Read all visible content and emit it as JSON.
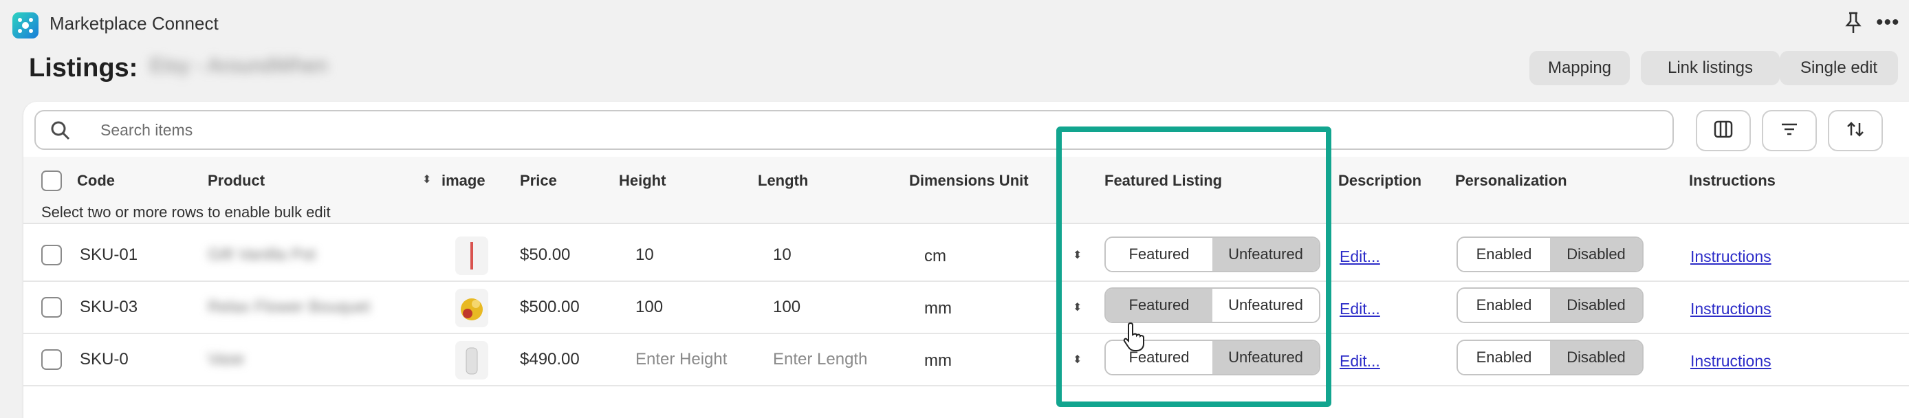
{
  "app": {
    "title": "Marketplace Connect"
  },
  "page": {
    "title": "Listings:",
    "store_name": "Etsy - AroundWhen"
  },
  "toolbar": {
    "mapping": "Mapping",
    "link_listings": "Link listings",
    "single_edit": "Single edit"
  },
  "search": {
    "placeholder": "Search items"
  },
  "table": {
    "columns": {
      "code": "Code",
      "product": "Product",
      "image": "image",
      "price": "Price",
      "height": "Height",
      "length": "Length",
      "dimensions_unit": "Dimensions Unit",
      "featured_listing": "Featured Listing",
      "description": "Description",
      "personalization": "Personalization",
      "instructions": "Instructions"
    },
    "bulk_note": "Select two or more rows to enable bulk edit",
    "rows": [
      {
        "code": "SKU-01",
        "product": "Gift Vanilla Pot",
        "price": "$50.00",
        "height": "10",
        "length": "10",
        "unit": "cm",
        "featured": "Featured",
        "unfeatured": "Unfeatured",
        "featured_state": "unfeatured",
        "description": "Edit...",
        "enabled": "Enabled",
        "disabled": "Disabled",
        "personalization_state": "disabled",
        "instructions": "Instructions"
      },
      {
        "code": "SKU-03",
        "product": "Relax Flower Bouquet",
        "price": "$500.00",
        "height": "100",
        "length": "100",
        "unit": "mm",
        "featured": "Featured",
        "unfeatured": "Unfeatured",
        "featured_state": "featured",
        "description": "Edit...",
        "enabled": "Enabled",
        "disabled": "Disabled",
        "personalization_state": "disabled",
        "instructions": "Instructions"
      },
      {
        "code": "SKU-0",
        "product": "Vase",
        "price": "$490.00",
        "height_placeholder": "Enter Height",
        "length_placeholder": "Enter Length",
        "unit": "mm",
        "featured": "Featured",
        "unfeatured": "Unfeatured",
        "featured_state": "unfeatured",
        "description": "Edit...",
        "enabled": "Enabled",
        "disabled": "Disabled",
        "personalization_state": "disabled",
        "instructions": "Instructions"
      }
    ]
  },
  "colors": {
    "highlight": "#12a58f",
    "link": "#2c2cc8",
    "segment_active": "#cdcdcd"
  },
  "icons": [
    "app-logo-icon",
    "pin-icon",
    "more-icon",
    "search-icon",
    "columns-icon",
    "filter-icon",
    "sort-icon",
    "sort-caret-icon",
    "pointer-cursor-icon"
  ]
}
